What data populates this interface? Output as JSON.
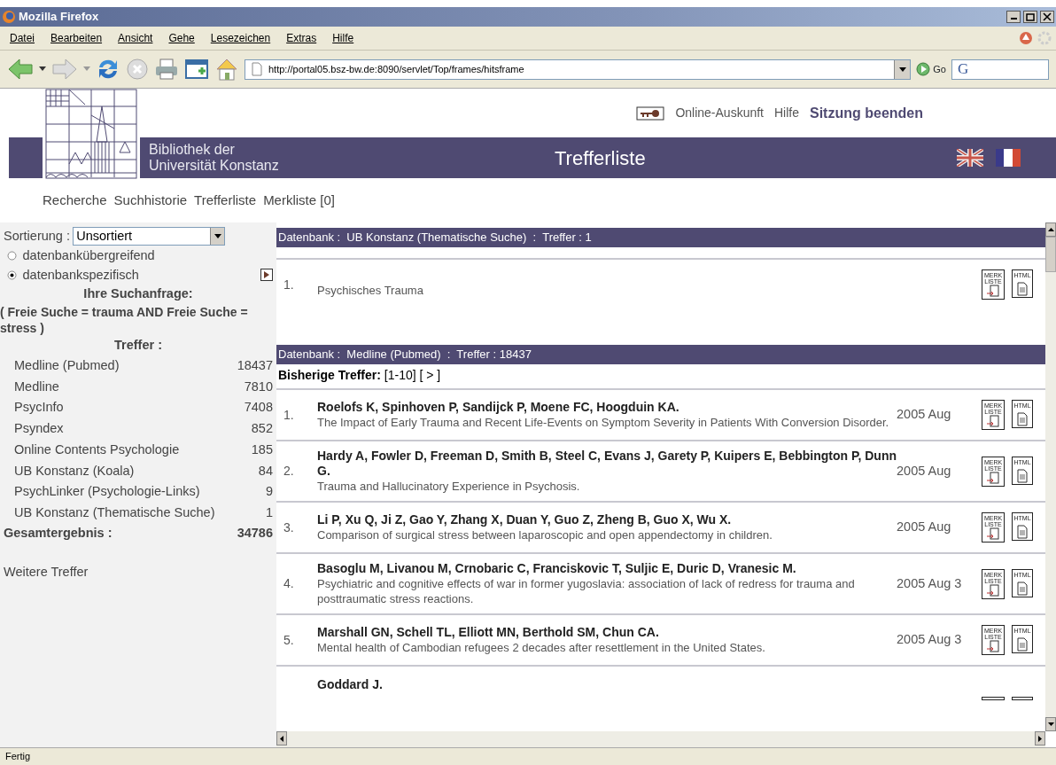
{
  "window": {
    "title": "Mozilla Firefox"
  },
  "menu": [
    "Datei",
    "Bearbeiten",
    "Ansicht",
    "Gehe",
    "Lesezeichen",
    "Extras",
    "Hilfe"
  ],
  "toolbar": {
    "url": "http://portal05.bsz-bw.de:8090/servlet/Top/frames/hitsframe",
    "go": "Go",
    "search_engine": "G"
  },
  "header": {
    "library": [
      "Bibliothek der",
      "Universität Konstanz"
    ],
    "page_title": "Trefferliste",
    "links": [
      {
        "label": "Online-Auskunft",
        "kind": "plain"
      },
      {
        "label": "Hilfe",
        "kind": "plain"
      },
      {
        "label": "Sitzung beenden",
        "kind": "strong"
      }
    ]
  },
  "nav": [
    "Recherche",
    "Suchhistorie",
    "Trefferliste",
    "Merkliste [0]"
  ],
  "sidebar": {
    "sort_label": "Sortierung :",
    "sort_value": "Unsortiert",
    "options": [
      {
        "label": "datenbankübergreifend",
        "selected": false
      },
      {
        "label": "datenbankspezifisch",
        "selected": true
      }
    ],
    "query_heading": "Ihre Suchanfrage:",
    "query": "( Freie Suche = trauma AND Freie Suche = stress )",
    "hits_heading": "Treffer :",
    "databases": [
      {
        "name": "Medline (Pubmed)",
        "count": "18437"
      },
      {
        "name": "Medline",
        "count": "7810"
      },
      {
        "name": "PsycInfo",
        "count": "7408"
      },
      {
        "name": "Psyndex",
        "count": "852"
      },
      {
        "name": "Online Contents Psychologie",
        "count": "185"
      },
      {
        "name": "UB Konstanz (Koala)",
        "count": "84"
      },
      {
        "name": "PsychLinker (Psychologie-Links)",
        "count": "9"
      },
      {
        "name": "UB Konstanz (Thematische Suche)",
        "count": "1"
      }
    ],
    "total_label": "Gesamtergebnis :",
    "total": "34786",
    "more": "Weitere Treffer"
  },
  "results": [
    {
      "header": "Datenbank :  UB Konstanz (Thematische Suche)  :  Treffer : 1",
      "hits": [
        {
          "number": "1.",
          "title": "Psychisches Trauma",
          "merk_label": "MERK LISTE",
          "html_label": "HTML"
        }
      ]
    },
    {
      "header": "Datenbank :  Medline (Pubmed)  :  Treffer : 18437",
      "pager": {
        "label": "Bisherige Treffer:",
        "text": "[1-10] [ > ]"
      },
      "hits": [
        {
          "number": "1.",
          "authors": "Roelofs K, Spinhoven P, Sandijck P, Moene FC, Hoogduin KA.",
          "title": "The Impact of Early Trauma and Recent Life-Events on Symptom Severity in Patients With Conversion Disorder.",
          "date": "2005 Aug",
          "merk_label": "MERK LISTE",
          "html_label": "HTML"
        },
        {
          "number": "2.",
          "authors": "Hardy A, Fowler D, Freeman D, Smith B, Steel C, Evans J, Garety P, Kuipers E, Bebbington P, Dunn G.",
          "title": "Trauma and Hallucinatory Experience in Psychosis.",
          "date": "2005 Aug",
          "merk_label": "MERK LISTE",
          "html_label": "HTML"
        },
        {
          "number": "3.",
          "authors": "Li P, Xu Q, Ji Z, Gao Y, Zhang X, Duan Y, Guo Z, Zheng B, Guo X, Wu X.",
          "title": "Comparison of surgical stress between laparoscopic and open appendectomy in children.",
          "date": "2005 Aug",
          "merk_label": "MERK LISTE",
          "html_label": "HTML"
        },
        {
          "number": "4.",
          "authors": "Basoglu M, Livanou M, Crnobaric C, Franciskovic T, Suljic E, Duric D, Vranesic M.",
          "title": "Psychiatric and cognitive effects of war in former yugoslavia: association of lack of redress for trauma and posttraumatic stress reactions.",
          "date": "2005 Aug 3",
          "merk_label": "MERK LISTE",
          "html_label": "HTML"
        },
        {
          "number": "5.",
          "authors": "Marshall GN, Schell TL, Elliott MN, Berthold SM, Chun CA.",
          "title": "Mental health of Cambodian refugees 2 decades after resettlement in the United States.",
          "date": "2005 Aug 3",
          "merk_label": "MERK LISTE",
          "html_label": "HTML"
        },
        {
          "authors": "Goddard J."
        }
      ]
    }
  ],
  "status_bar": "Fertig"
}
